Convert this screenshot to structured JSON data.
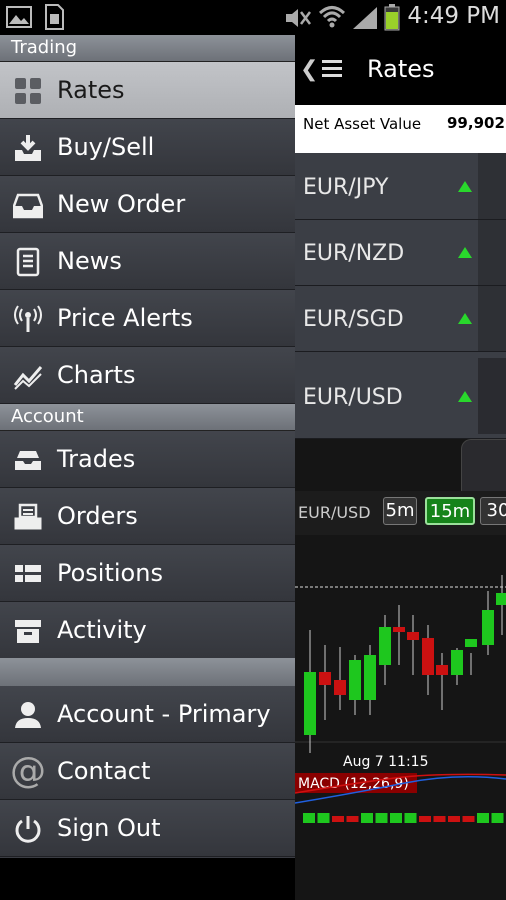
{
  "status_bar": {
    "time": "4:49 PM"
  },
  "drawer": {
    "sections": [
      {
        "label": "Trading"
      },
      {
        "label": "Account"
      }
    ],
    "trading_items": [
      {
        "label": "Rates",
        "icon": "grid-icon",
        "selected": true
      },
      {
        "label": "Buy/Sell",
        "icon": "download-tray-icon"
      },
      {
        "label": "New Order",
        "icon": "inbox-icon"
      },
      {
        "label": "News",
        "icon": "document-icon"
      },
      {
        "label": "Price Alerts",
        "icon": "antenna-icon"
      },
      {
        "label": "Charts",
        "icon": "line-chart-icon"
      }
    ],
    "account_items": [
      {
        "label": "Trades",
        "icon": "tray-stack-icon"
      },
      {
        "label": "Orders",
        "icon": "orders-tray-icon"
      },
      {
        "label": "Positions",
        "icon": "positions-grid-icon"
      },
      {
        "label": "Activity",
        "icon": "archive-box-icon"
      }
    ],
    "bottom_items": [
      {
        "label": "Account - Primary",
        "icon": "user-icon"
      },
      {
        "label": "Contact",
        "icon": "at-sign-icon"
      },
      {
        "label": "Sign Out",
        "icon": "power-icon"
      }
    ]
  },
  "app": {
    "title": "Rates",
    "nav_label": "Net Asset Value",
    "nav_value": "99,902.",
    "rates": [
      {
        "pair": "EUR/JPY",
        "direction": "up"
      },
      {
        "pair": "EUR/NZD",
        "direction": "up"
      },
      {
        "pair": "EUR/SGD",
        "direction": "up"
      },
      {
        "pair": "EUR/USD",
        "direction": "up"
      }
    ],
    "chart": {
      "pair": "EUR/USD",
      "timeframes": [
        "5m",
        "15m",
        "30"
      ],
      "active_timeframe": "15m",
      "time_label": "Aug 7 11:15",
      "indicator": "MACD (12,26,9)",
      "colors": {
        "up": "#1ec71e",
        "down": "#cc1111",
        "macd_line": "#d01010",
        "signal_line": "#2060e0"
      }
    }
  }
}
